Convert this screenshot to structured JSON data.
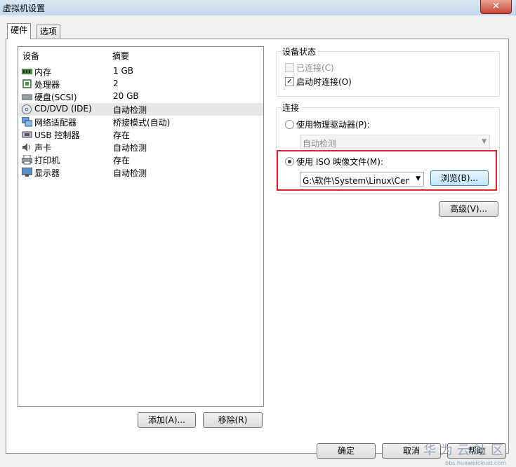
{
  "window": {
    "title": "虚拟机设置",
    "close_glyph": "✕"
  },
  "tabs": [
    {
      "label": "硬件"
    },
    {
      "label": "选项"
    }
  ],
  "device_list": {
    "headers": {
      "device": "设备",
      "summary": "摘要"
    },
    "rows": [
      {
        "device": "内存",
        "summary": "1 GB",
        "icon": "memory-icon"
      },
      {
        "device": "处理器",
        "summary": "2",
        "icon": "processor-icon"
      },
      {
        "device": "硬盘(SCSI)",
        "summary": "20 GB",
        "icon": "harddisk-icon"
      },
      {
        "device": "CD/DVD (IDE)",
        "summary": "自动检测",
        "icon": "cd-dvd-icon"
      },
      {
        "device": "网络适配器",
        "summary": "桥接模式(自动)",
        "icon": "network-adapter-icon"
      },
      {
        "device": "USB 控制器",
        "summary": "存在",
        "icon": "usb-icon"
      },
      {
        "device": "声卡",
        "summary": "自动检测",
        "icon": "sound-card-icon"
      },
      {
        "device": "打印机",
        "summary": "存在",
        "icon": "printer-icon"
      },
      {
        "device": "显示器",
        "summary": "自动检测",
        "icon": "display-icon"
      }
    ],
    "selected_index": 3
  },
  "list_buttons": {
    "add": "添加(A)...",
    "remove": "移除(R)"
  },
  "device_status": {
    "title": "设备状态",
    "connected": {
      "label": "已连接(C)",
      "checked": false,
      "enabled": false
    },
    "connect_at_power_on": {
      "label": "启动时连接(O)",
      "checked": true,
      "check_glyph": "✓"
    }
  },
  "connection": {
    "title": "连接",
    "physical_drive": {
      "label": "使用物理驱动器(P):",
      "selected": false,
      "combo_value": "自动检测"
    },
    "iso_image": {
      "label": "使用 ISO 映像文件(M):",
      "selected": true,
      "path": "G:\\软件\\System\\Linux\\Cent",
      "browse": "浏览(B)..."
    }
  },
  "advanced_button": "高级(V)...",
  "footer": {
    "ok": "确定",
    "cancel": "取消",
    "help": "帮助"
  },
  "watermark": {
    "text": "华为云社区",
    "sub": "bbs.huaweicloud.com"
  },
  "colors": {
    "highlight_box": "#e0262b",
    "selected_row": "#e7e7e7"
  }
}
